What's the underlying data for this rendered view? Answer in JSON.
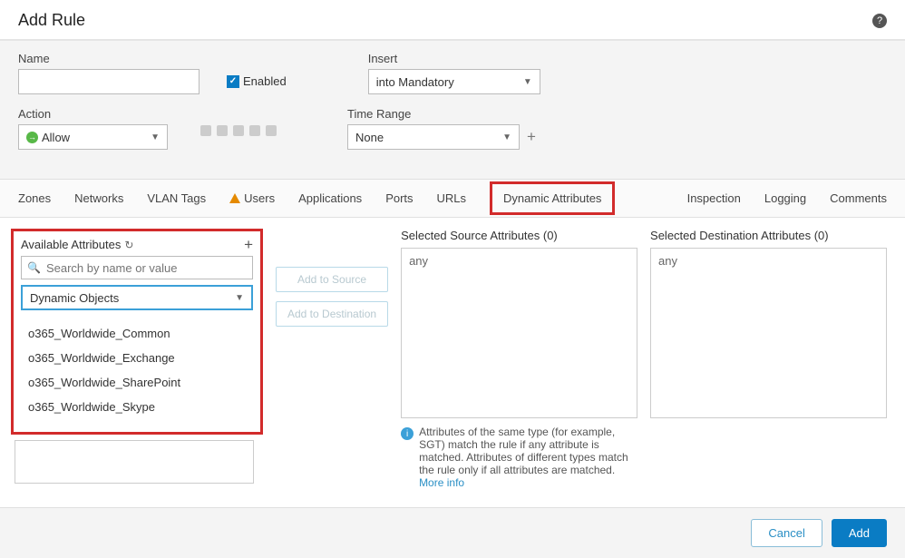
{
  "header": {
    "title": "Add Rule"
  },
  "form": {
    "name_label": "Name",
    "name_value": "",
    "enabled_label": "Enabled",
    "action_label": "Action",
    "action_value": "Allow",
    "insert_label": "Insert",
    "insert_value": "into Mandatory",
    "time_label": "Time Range",
    "time_value": "None"
  },
  "tabs": {
    "left": [
      "Zones",
      "Networks",
      "VLAN Tags",
      "Users",
      "Applications",
      "Ports",
      "URLs",
      "Dynamic Attributes"
    ],
    "right": [
      "Inspection",
      "Logging",
      "Comments"
    ],
    "active": "Dynamic Attributes",
    "warning_tab": "Users"
  },
  "available": {
    "title": "Available Attributes",
    "search_placeholder": "Search by name or value",
    "type_value": "Dynamic Objects",
    "items": [
      "o365_Worldwide_Common",
      "o365_Worldwide_Exchange",
      "o365_Worldwide_SharePoint",
      "o365_Worldwide_Skype"
    ]
  },
  "buttons": {
    "add_source": "Add to Source",
    "add_dest": "Add to Destination"
  },
  "selected_source": {
    "label": "Selected Source Attributes (0)",
    "placeholder": "any"
  },
  "selected_dest": {
    "label": "Selected Destination Attributes (0)",
    "placeholder": "any"
  },
  "info": {
    "text": "Attributes of the same type (for example, SGT) match the rule if any attribute is matched. Attributes of different types match the rule only if all attributes are matched. ",
    "link": "More info"
  },
  "footer": {
    "cancel": "Cancel",
    "add": "Add"
  }
}
